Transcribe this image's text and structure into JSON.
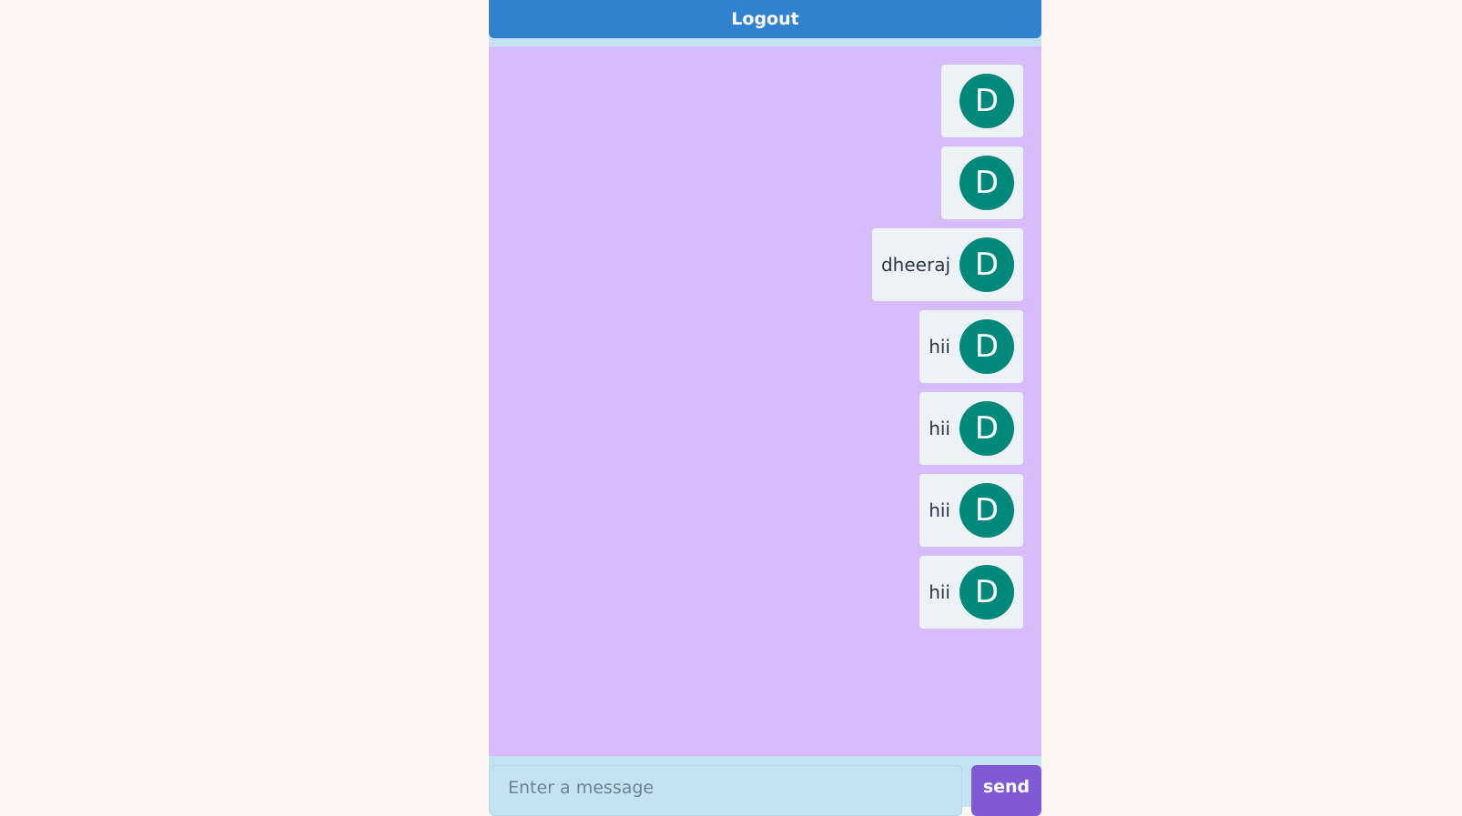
{
  "header": {
    "logout_label": "Logout"
  },
  "messages": [
    {
      "text": "",
      "avatar_initial": "D"
    },
    {
      "text": "",
      "avatar_initial": "D"
    },
    {
      "text": "dheeraj",
      "avatar_initial": "D"
    },
    {
      "text": "hii",
      "avatar_initial": "D"
    },
    {
      "text": "hii",
      "avatar_initial": "D"
    },
    {
      "text": "hii",
      "avatar_initial": "D"
    },
    {
      "text": "hii",
      "avatar_initial": "D"
    }
  ],
  "composer": {
    "placeholder": "Enter a message",
    "value": "",
    "send_label": "send"
  },
  "colors": {
    "page_background": "#fff5f3",
    "logout_button": "#3182ce",
    "chat_background": "#d6bcfa",
    "message_bubble": "#edf2f7",
    "avatar": "#00897b",
    "composer_background": "#c3e3f2",
    "send_button": "#805ad5"
  }
}
